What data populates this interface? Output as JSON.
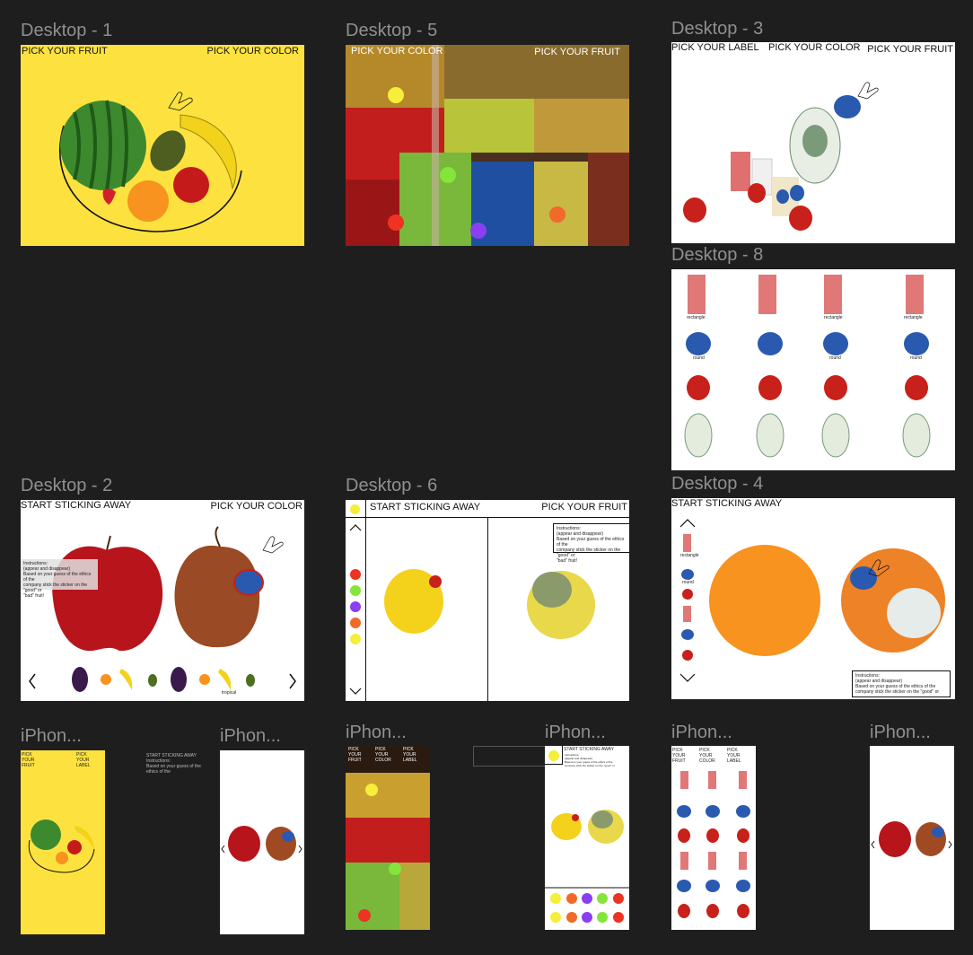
{
  "frames": {
    "d1": {
      "title": "Desktop - 1",
      "left": "PICK YOUR FRUIT",
      "right": "PICK YOUR COLOR"
    },
    "d5": {
      "title": "Desktop - 5",
      "left": "PICK YOUR COLOR",
      "right": "PICK YOUR FRUIT"
    },
    "d3": {
      "title": "Desktop - 3",
      "a": "PICK YOUR LABEL",
      "b": "PICK YOUR COLOR",
      "c": "PICK YOUR FRUIT"
    },
    "d8": {
      "title": "Desktop - 8",
      "labels": [
        "rectangle",
        "round"
      ]
    },
    "d2": {
      "title": "Desktop - 2",
      "left": "START STICKING AWAY",
      "right": "PICK YOUR COLOR",
      "tropical": "tropical"
    },
    "d6": {
      "title": "Desktop - 6",
      "left": "START STICKING AWAY",
      "right": "PICK YOUR FRUIT"
    },
    "d4": {
      "title": "Desktop - 4",
      "left": "START STICKING AWAY",
      "rect": "rectangle",
      "round": "round"
    },
    "p1": {
      "title": "iPhon...",
      "a": "PICK YOUR FRUIT",
      "b": "PICK YOUR LABEL"
    },
    "p2": {
      "title": "iPhon..."
    },
    "p3": {
      "title": "iPhon...",
      "a": "PICK YOUR FRUIT",
      "b": "PICK YOUR COLOR",
      "c": "PICK YOUR LABEL"
    },
    "p4": {
      "title": "iPhon...",
      "a": "START STICKING AWAY"
    },
    "p5": {
      "title": "iPhon...",
      "a": "PICK YOUR FRUIT",
      "b": "PICK YOUR COLOR",
      "c": "PICK YOUR LABEL"
    },
    "p6": {
      "title": "iPhon..."
    }
  },
  "instructions": {
    "l1": "Instructions:",
    "l2": "(appear and disappear)",
    "l3": "Based on your guess of the ethics of the",
    "l4": "company stick the sticker on the \"good\" or",
    "l5": "\"bad\" fruit!"
  },
  "colors": {
    "canvas": "#1e1e1e",
    "yellow_bg": "#fde23f",
    "dot_yellow": "#f5ee3a",
    "dot_green": "#84e53a",
    "dot_red": "#ee3322",
    "dot_purple": "#8a3ff0",
    "dot_orange": "#f06a2a"
  }
}
